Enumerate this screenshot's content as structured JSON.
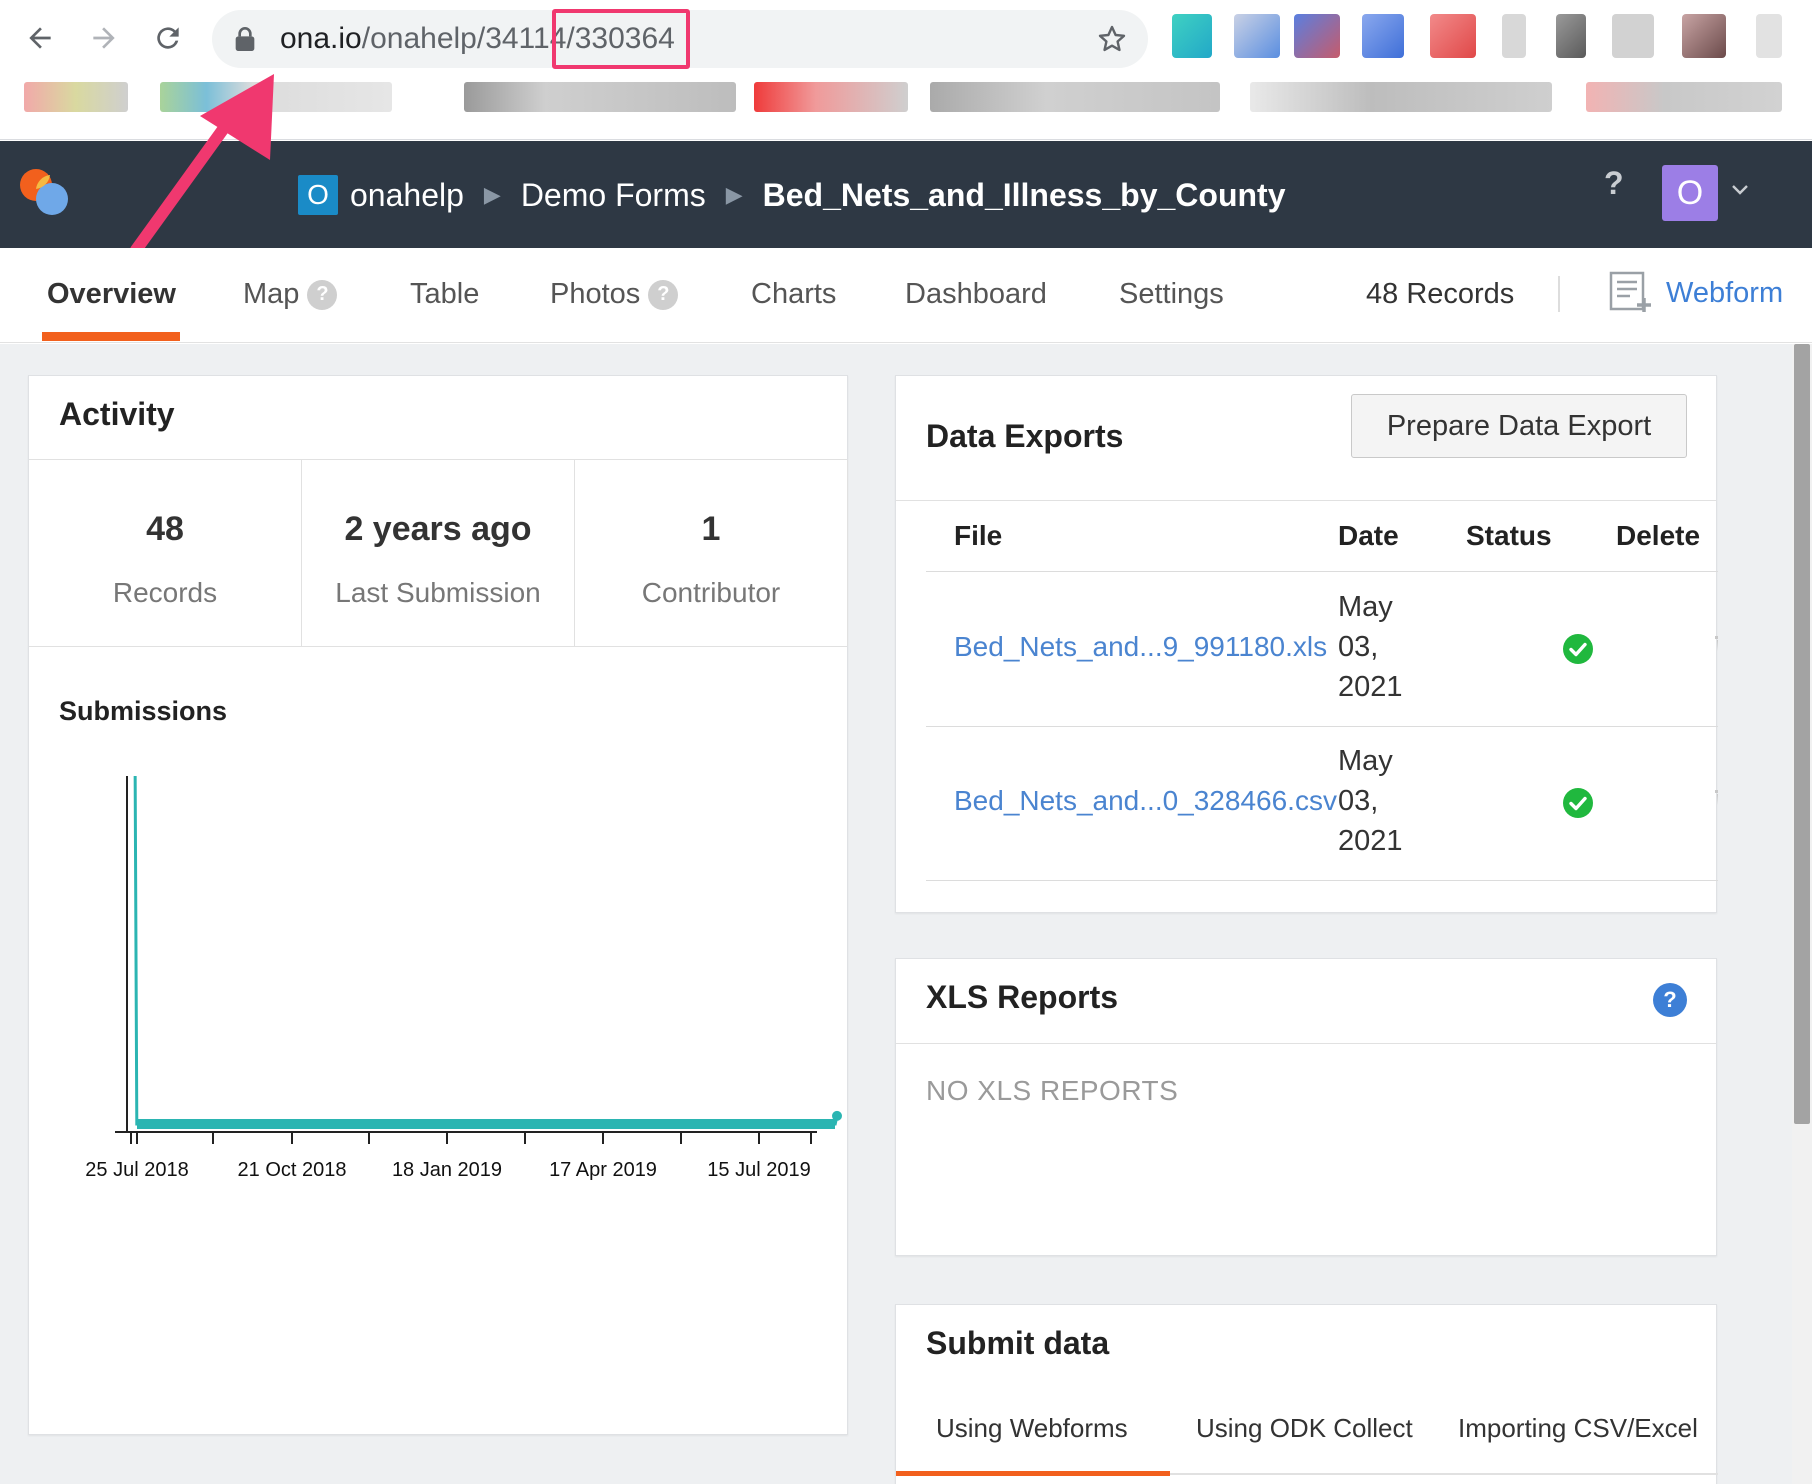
{
  "browser": {
    "url_host": "ona.io",
    "url_path": "/onahelp/34114/330364"
  },
  "header": {
    "org_badge": "O",
    "breadcrumb": [
      "onahelp",
      "Demo Forms",
      "Bed_Nets_and_Illness_by_County"
    ],
    "help": "?",
    "avatar": "O"
  },
  "tabs": {
    "items": [
      {
        "label": "Overview",
        "active": true
      },
      {
        "label": "Map",
        "badge": "?"
      },
      {
        "label": "Table"
      },
      {
        "label": "Photos",
        "badge": "?"
      },
      {
        "label": "Charts"
      },
      {
        "label": "Dashboard"
      },
      {
        "label": "Settings"
      }
    ],
    "records": "48 Records",
    "webform": "Webform"
  },
  "activity": {
    "title": "Activity",
    "stats": [
      {
        "value": "48",
        "label": "Records"
      },
      {
        "value": "2 years ago",
        "label": "Last Submission"
      },
      {
        "value": "1",
        "label": "Contributor"
      }
    ],
    "submissions_title": "Submissions"
  },
  "chart_data": {
    "type": "line",
    "title": "Submissions",
    "xlabel": "",
    "ylabel": "",
    "x_ticks": [
      "25 Jul 2018",
      "21 Oct 2018",
      "18 Jan 2019",
      "17 Apr 2019",
      "15 Jul 2019"
    ],
    "x_range": [
      "2018-07-22",
      "2019-08-12"
    ],
    "series": [
      {
        "color": "#2bb5b2",
        "points": [
          {
            "x": "2018-07-25",
            "y": 47
          },
          {
            "x": "2018-07-26",
            "y": 0
          },
          {
            "x": "2019-08-10",
            "y": 0
          },
          {
            "x": "2019-08-11",
            "y": 1
          }
        ]
      }
    ],
    "ylim": [
      0,
      50
    ],
    "grid": false
  },
  "exports": {
    "title": "Data Exports",
    "prepare_button": "Prepare Data Export",
    "columns": [
      "File",
      "Date",
      "Status",
      "Delete"
    ],
    "rows": [
      {
        "file": "Bed_Nets_and...9_991180.xls",
        "date": "May 03, 2021",
        "status": "success-icon"
      },
      {
        "file": "Bed_Nets_and...0_328466.csv",
        "date": "May 03, 2021",
        "status": "success-icon"
      }
    ]
  },
  "xls_reports": {
    "title": "XLS Reports",
    "help": "?",
    "empty": "NO XLS REPORTS"
  },
  "submit": {
    "title": "Submit data",
    "tabs": [
      "Using Webforms",
      "Using ODK Collect",
      "Importing CSV/Excel"
    ]
  },
  "colors": {
    "header_bg": "#2e3844",
    "accent": "#f2601d",
    "link": "#4a84d0",
    "success": "#20b83e",
    "chart_line": "#2bb5b2",
    "annotation": "#f0386f"
  }
}
